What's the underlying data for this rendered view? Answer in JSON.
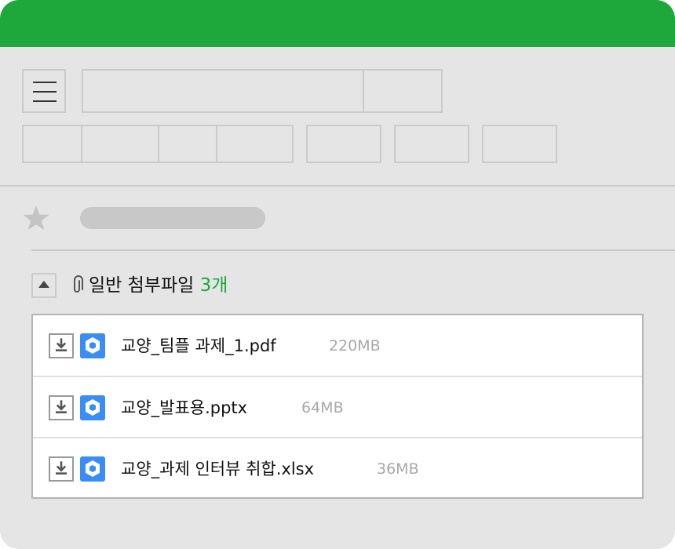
{
  "colors": {
    "header_bar": "#1ea83c",
    "background": "#e5e5e5",
    "count_accent": "#1ea83c",
    "file_icon": "#3a8df5"
  },
  "attachments": {
    "label": "일반 첨부파일",
    "count": "3개",
    "files": [
      {
        "name": "교양_팀플 과제_1.pdf",
        "size": "220MB",
        "icon": "cube-file-icon"
      },
      {
        "name": "교양_발표용.pptx",
        "size": "64MB",
        "icon": "cube-file-icon"
      },
      {
        "name": "교양_과제 인터뷰 취합.xlsx",
        "size": "36MB",
        "icon": "cube-file-icon"
      }
    ]
  }
}
